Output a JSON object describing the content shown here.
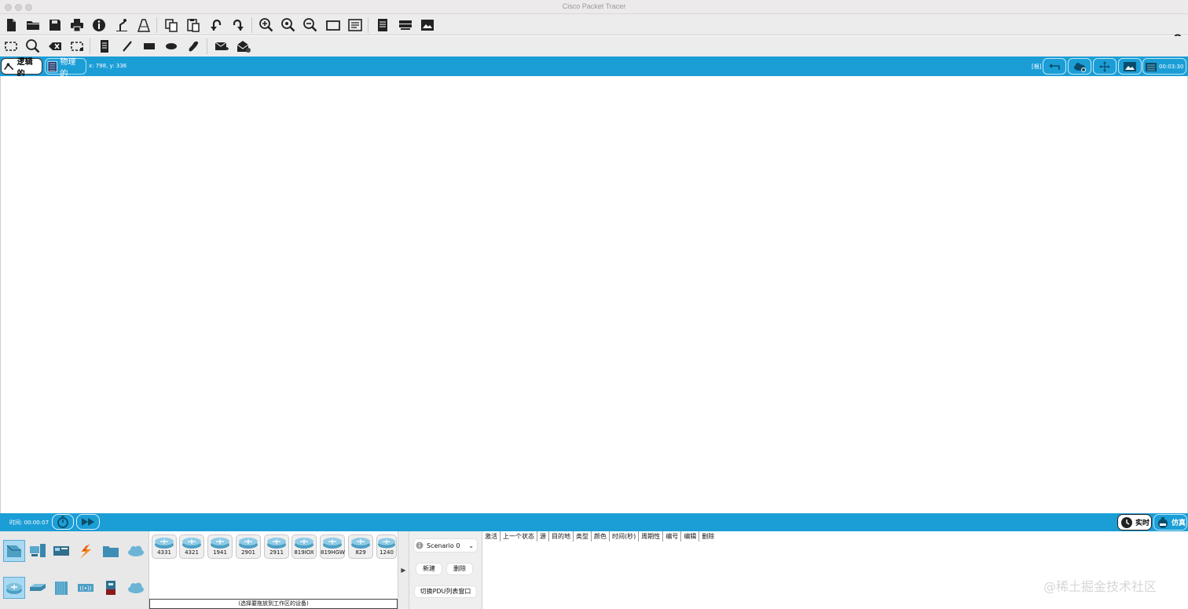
{
  "window": {
    "title": "Cisco Packet Tracer"
  },
  "toolbar_top": {
    "buttons": [
      "new-file-icon",
      "open-folder-icon",
      "save-icon",
      "print-icon",
      "info-icon",
      "activity-wizard-icon",
      "custom-device-icon",
      "copy-icon",
      "paste-icon",
      "undo-icon",
      "redo-icon",
      "zoom-in-icon",
      "zoom-reset-icon",
      "zoom-out-icon",
      "drawing-palette-icon",
      "custom-device-dialog-icon",
      "notes-icon",
      "device-list-icon",
      "screenshot-icon"
    ],
    "help": "?"
  },
  "toolbar_tools": {
    "buttons": [
      "select-icon",
      "inspect-icon",
      "delete-icon",
      "resize-icon",
      "note-icon",
      "line-icon",
      "rectangle-icon",
      "ellipse-icon",
      "freeform-icon",
      "simple-pdu-icon",
      "complex-pdu-icon"
    ]
  },
  "workspace_bar": {
    "tab_logical": "逻辑的",
    "tab_physical": "物理的",
    "coords": "x: 798, y: 336",
    "view_tag": "[根]",
    "clock": "00:03:30"
  },
  "time_bar": {
    "time_label": "时间: 00:00:07",
    "realtime": "实时",
    "simulation": "仿真"
  },
  "devices": {
    "models": [
      "4331",
      "4321",
      "1941",
      "2901",
      "2911",
      "819IOX",
      "819HGW",
      "829",
      "1240"
    ],
    "hint": "(选择要拖放到工作区的设备)"
  },
  "scenario": {
    "selected": "Scenario 0",
    "new_label": "新建",
    "delete_label": "删除",
    "toggle_label": "切换PDU列表窗口"
  },
  "pdu_columns": [
    "激活",
    "上一个状态",
    "源",
    "目的地",
    "类型",
    "颜色",
    "时间(秒)",
    "周期性",
    "编号",
    "编辑",
    "删除"
  ],
  "colors": {
    "accent": "#1b9ed6",
    "selected_category": "#a8d9f2"
  },
  "watermark": "@稀土掘金技术社区"
}
